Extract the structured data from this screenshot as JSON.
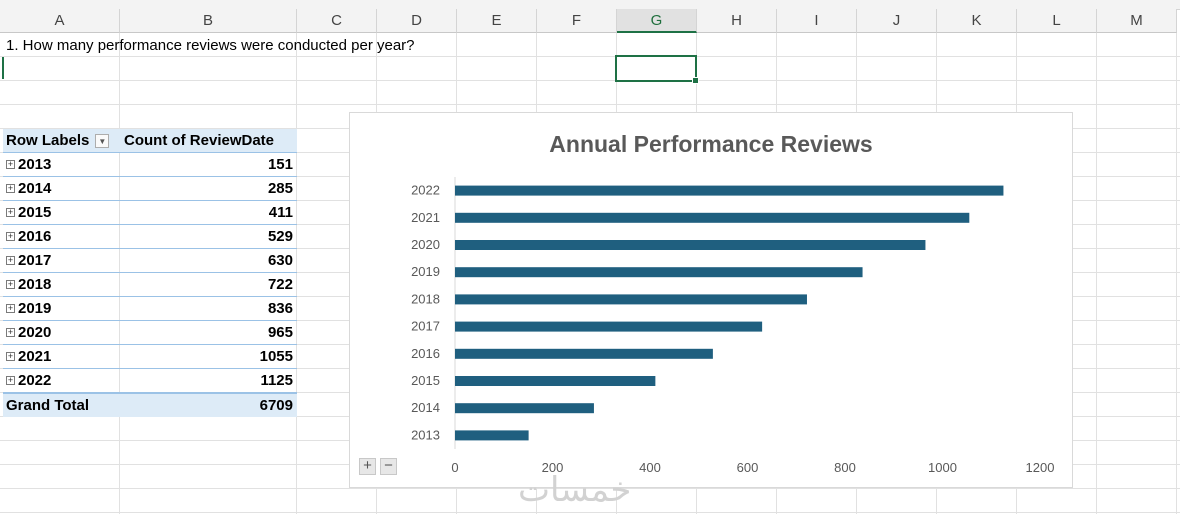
{
  "columns": [
    "A",
    "B",
    "C",
    "D",
    "E",
    "F",
    "G",
    "H",
    "I",
    "J",
    "K",
    "L",
    "M"
  ],
  "selected_column": "G",
  "question_text": "1. How many performance reviews were conducted per year?",
  "pivot": {
    "header": {
      "row_labels": "Row Labels",
      "value_label": "Count of ReviewDate"
    },
    "rows": [
      {
        "label": "2013",
        "value": "151"
      },
      {
        "label": "2014",
        "value": "285"
      },
      {
        "label": "2015",
        "value": "411"
      },
      {
        "label": "2016",
        "value": "529"
      },
      {
        "label": "2017",
        "value": "630"
      },
      {
        "label": "2018",
        "value": "722"
      },
      {
        "label": "2019",
        "value": "836"
      },
      {
        "label": "2020",
        "value": "965"
      },
      {
        "label": "2021",
        "value": "1055"
      },
      {
        "label": "2022",
        "value": "1125"
      }
    ],
    "grand_total": {
      "label": "Grand Total",
      "value": "6709"
    }
  },
  "chart_data": {
    "type": "bar",
    "orientation": "horizontal",
    "title": "Annual Performance Reviews",
    "categories": [
      "2013",
      "2014",
      "2015",
      "2016",
      "2017",
      "2018",
      "2019",
      "2020",
      "2021",
      "2022"
    ],
    "values": [
      151,
      285,
      411,
      529,
      630,
      722,
      836,
      965,
      1055,
      1125
    ],
    "x_ticks": [
      "0",
      "200",
      "400",
      "600",
      "800",
      "1000",
      "1200"
    ],
    "xlim": [
      0,
      1200
    ],
    "bar_color": "#1f5f7f",
    "grid": false,
    "legend": "none"
  },
  "chart_controls": {
    "zoom_in": "+",
    "zoom_out": "−"
  },
  "watermark_text": "خمسات",
  "colors": {
    "accent": "#1e7145",
    "pivot_header": "#ddebf7",
    "pivot_border": "#9bc2e6"
  }
}
